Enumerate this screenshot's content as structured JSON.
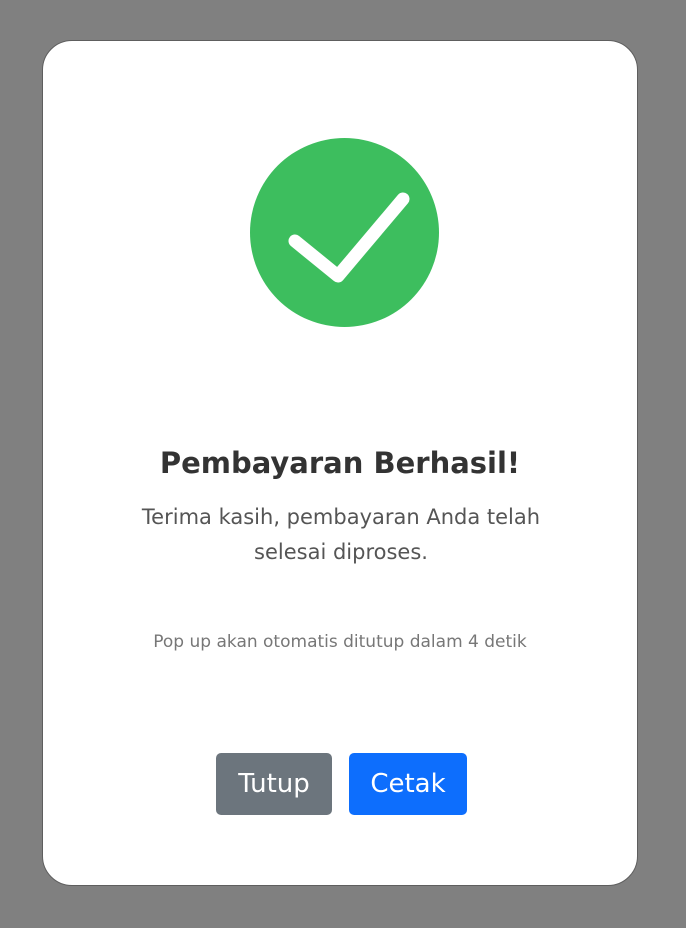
{
  "colors": {
    "overlay": "#808080",
    "modal_background": "#ffffff",
    "success": "#3dbe5e",
    "close_button": "#6c757d",
    "print_button": "#0d6efd"
  },
  "icons": {
    "success": "check-circle-icon"
  },
  "dialog": {
    "title": "Pembayaran Berhasil!",
    "message": "Terima kasih, pembayaran Anda telah selesai diproses.",
    "countdown": "Pop up akan otomatis ditutup dalam 4 detik",
    "buttons": {
      "close_label": "Tutup",
      "print_label": "Cetak"
    }
  }
}
